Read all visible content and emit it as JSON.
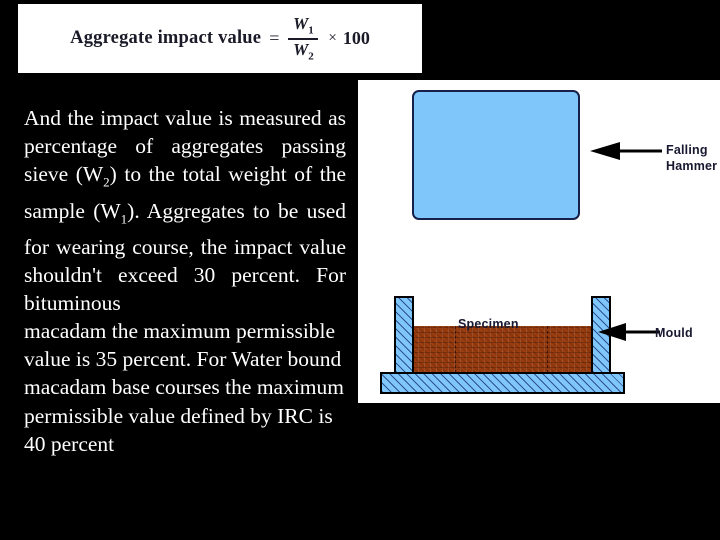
{
  "slide": {
    "background_color": "#000000",
    "text_color": "#ffffff"
  },
  "formula": {
    "lhs": "Aggregate impact value",
    "equals": "=",
    "numerator": "W",
    "numerator_sub": "1",
    "denominator": "W",
    "denominator_sub": "2",
    "times": "×",
    "multiplier": "100",
    "panel_color": "#ffffff",
    "ink_color": "#1a1a28"
  },
  "body": {
    "para_1": "And the impact value is measured as percentage of aggregates passing sieve (W",
    "para_1_sub": "2",
    "para_1_cont": ") to the total weight of the sample (W",
    "para_1_sub2": "1",
    "para_1_cont2": "). Aggregates to be used for wearing course, the impact value shouldn't exceed 30 percent. For bituminous",
    "para_2": "macadam the maximum permissible value is 35 percent. For Water bound macadam base courses the maximum permissible value defined by IRC is 40 percent",
    "values": {
      "wearing_course_max_percent": "30 percent",
      "bituminous_macadam_max_percent": "35 percent",
      "water_bound_macadam_irc_percent": "40 percent"
    }
  },
  "diagram": {
    "panel_color": "#ffffff",
    "hammer_box": {
      "fill_color": "#7fc7fb",
      "border_color": "#16204a"
    },
    "hammer_label_line1": "Falling",
    "hammer_label_line2": "Hammer",
    "mould_label": "Mould",
    "specimen_label": "Specimen",
    "specimen_color": "#9c3d10",
    "mould_wall_color": "#7fc7fb",
    "mould_outline_color": "#000000",
    "arrow_color": "#000000",
    "label_color": "#181830"
  }
}
